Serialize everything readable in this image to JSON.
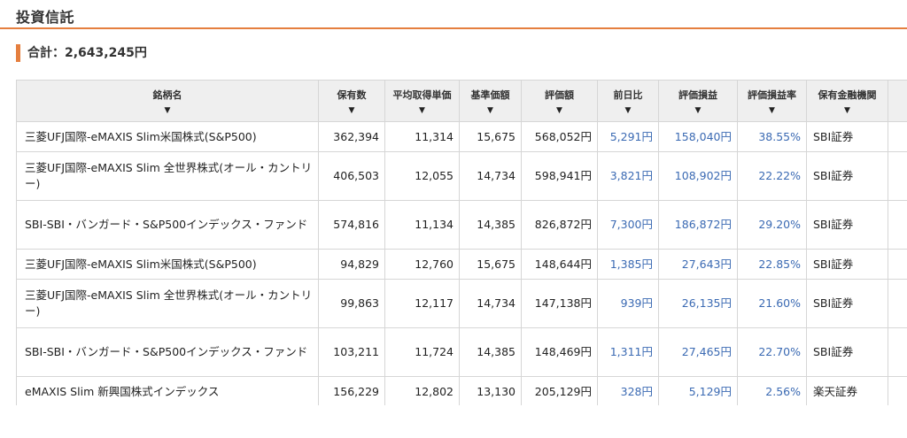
{
  "section_title": "投資信託",
  "total": {
    "label": "合計：",
    "value": "2,643,245円"
  },
  "columns": [
    {
      "label": "銘柄名"
    },
    {
      "label": "保有数"
    },
    {
      "label": "平均取得単価"
    },
    {
      "label": "基準価額"
    },
    {
      "label": "評価額"
    },
    {
      "label": "前日比"
    },
    {
      "label": "評価損益"
    },
    {
      "label": "評価損益率"
    },
    {
      "label": "保有金融機関"
    }
  ],
  "sort_arrow": "▼",
  "rows": [
    {
      "name": "三菱UFJ国際-eMAXIS Slim米国株式(S&P500)",
      "shares": "362,394",
      "avg_cost": "11,314",
      "nav": "15,675",
      "value": "568,052円",
      "day_change": "5,291円",
      "gain": "158,040円",
      "gain_rate": "38.55%",
      "institution": "SBI証券"
    },
    {
      "name": "三菱UFJ国際-eMAXIS Slim 全世界株式(オール・カントリー)",
      "shares": "406,503",
      "avg_cost": "12,055",
      "nav": "14,734",
      "value": "598,941円",
      "day_change": "3,821円",
      "gain": "108,902円",
      "gain_rate": "22.22%",
      "institution": "SBI証券"
    },
    {
      "name": "SBI-SBI・バンガード・S&P500インデックス・ファンド",
      "shares": "574,816",
      "avg_cost": "11,134",
      "nav": "14,385",
      "value": "826,872円",
      "day_change": "7,300円",
      "gain": "186,872円",
      "gain_rate": "29.20%",
      "institution": "SBI証券"
    },
    {
      "name": "三菱UFJ国際-eMAXIS Slim米国株式(S&P500)",
      "shares": "94,829",
      "avg_cost": "12,760",
      "nav": "15,675",
      "value": "148,644円",
      "day_change": "1,385円",
      "gain": "27,643円",
      "gain_rate": "22.85%",
      "institution": "SBI証券"
    },
    {
      "name": "三菱UFJ国際-eMAXIS Slim 全世界株式(オール・カントリー)",
      "shares": "99,863",
      "avg_cost": "12,117",
      "nav": "14,734",
      "value": "147,138円",
      "day_change": "939円",
      "gain": "26,135円",
      "gain_rate": "21.60%",
      "institution": "SBI証券"
    },
    {
      "name": "SBI-SBI・バンガード・S&P500インデックス・ファンド",
      "shares": "103,211",
      "avg_cost": "11,724",
      "nav": "14,385",
      "value": "148,469円",
      "day_change": "1,311円",
      "gain": "27,465円",
      "gain_rate": "22.70%",
      "institution": "SBI証券"
    },
    {
      "name": "eMAXIS Slim 新興国株式インデックス",
      "shares": "156,229",
      "avg_cost": "12,802",
      "nav": "13,130",
      "value": "205,129円",
      "day_change": "328円",
      "gain": "5,129円",
      "gain_rate": "2.56%",
      "institution": "楽天証券"
    }
  ],
  "colors": {
    "accent": "#e57f3f",
    "link": "#3b6ab3",
    "header_bg": "#efefef",
    "border": "#d6d6d6"
  }
}
